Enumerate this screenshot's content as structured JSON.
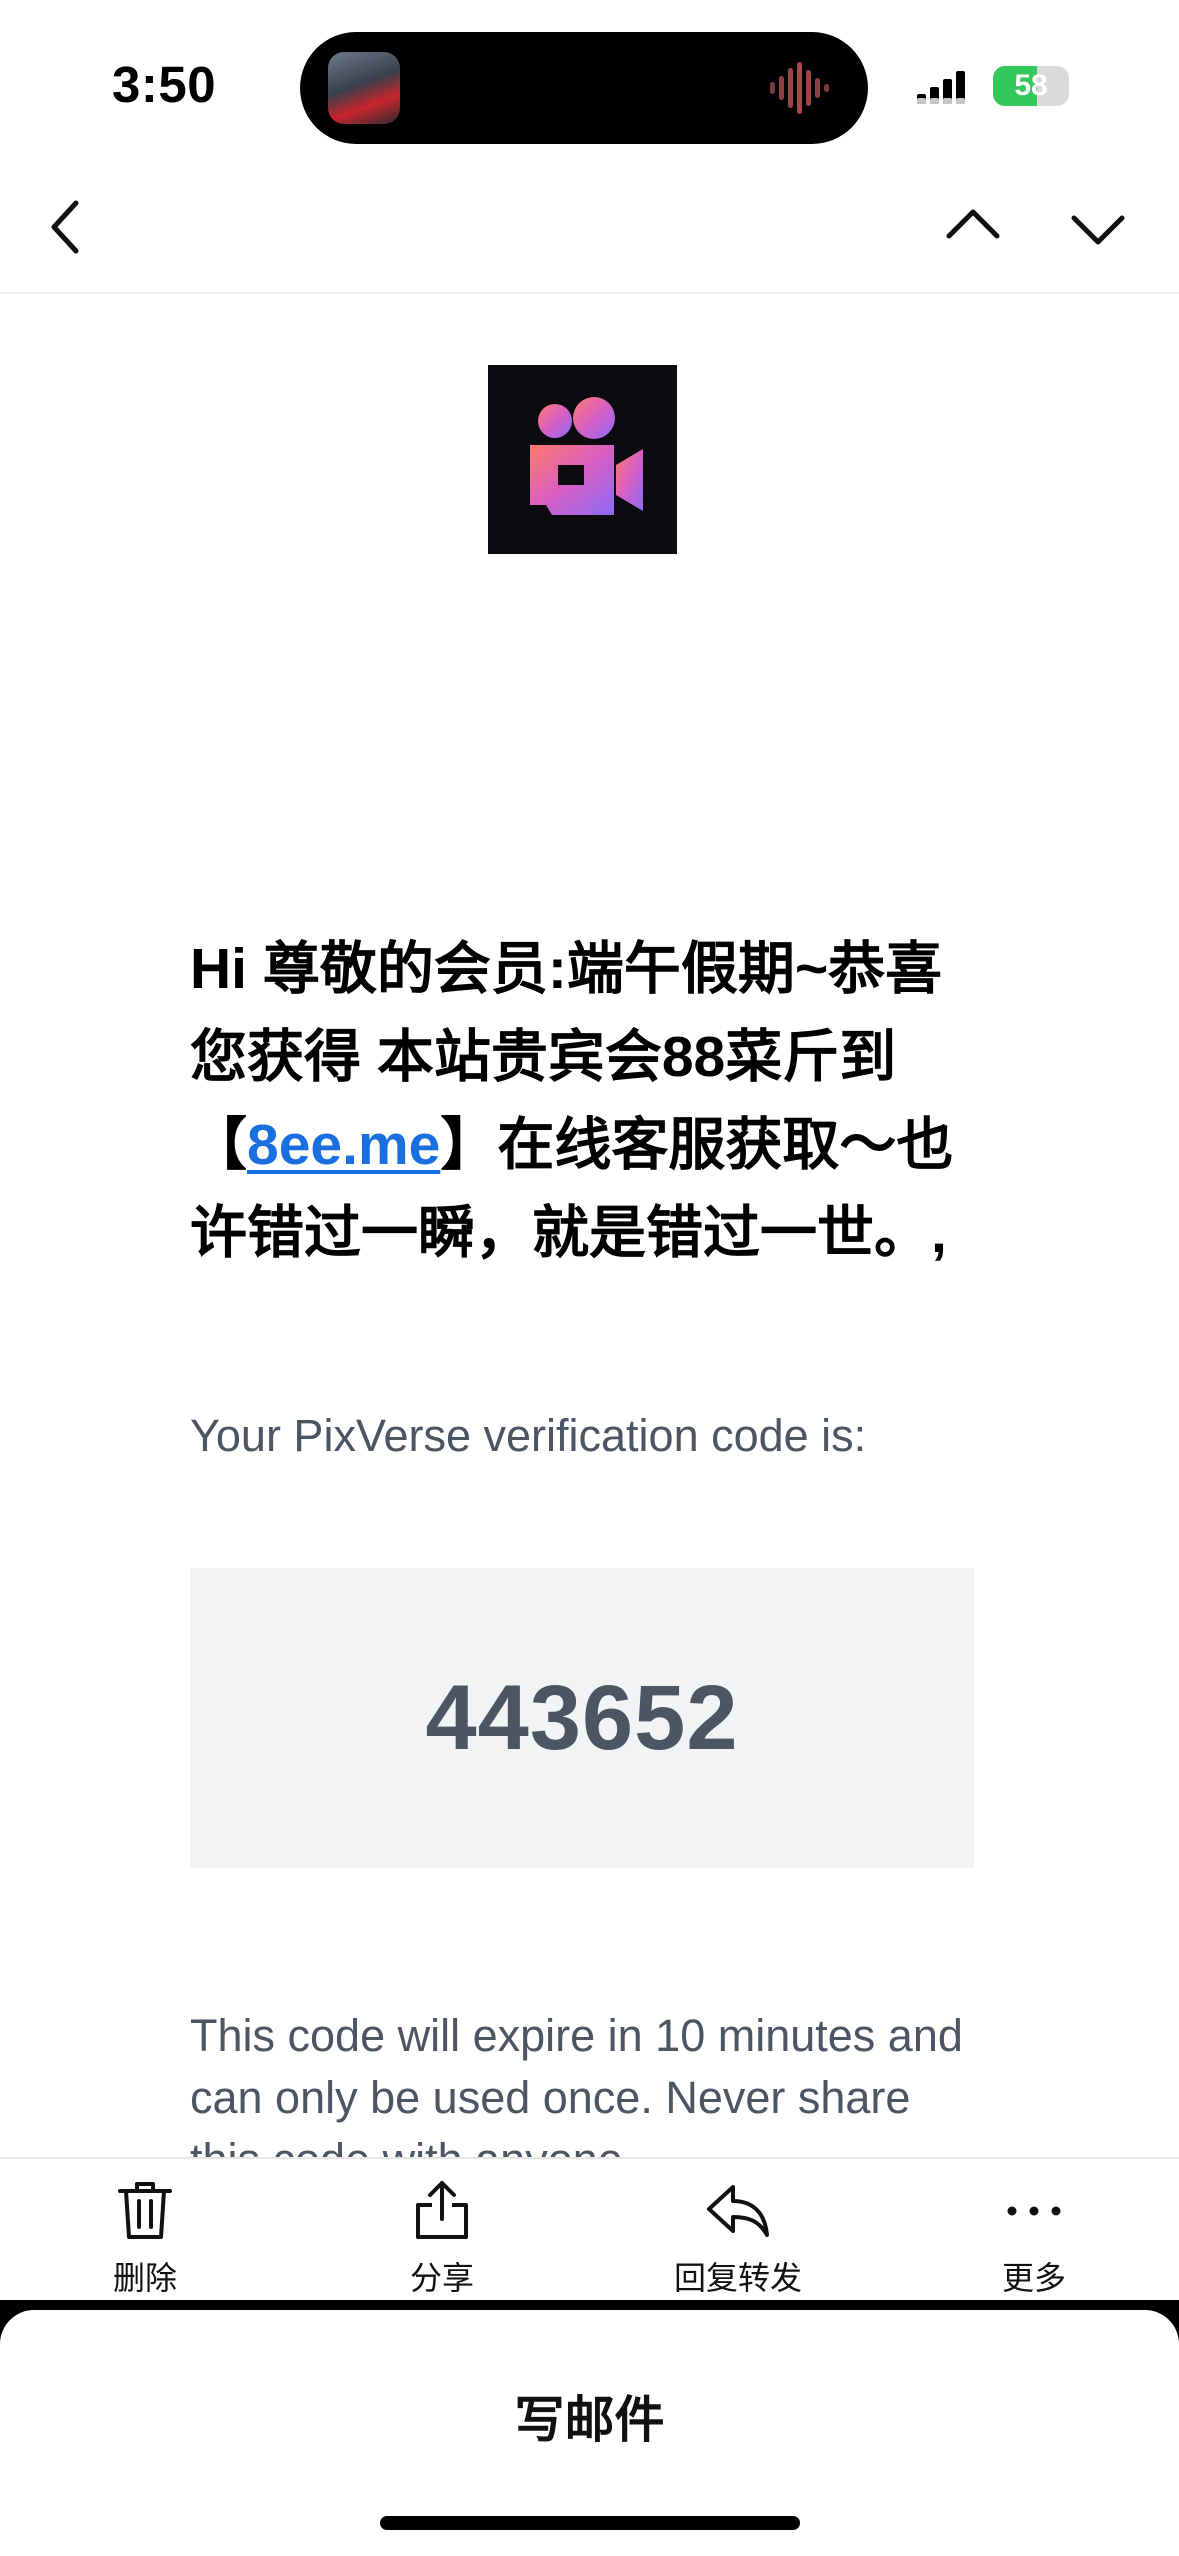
{
  "status_bar": {
    "time": "3:50",
    "battery_text": "58",
    "battery_level": 0.58
  },
  "nav": {
    "back_icon": "chevron-left-icon",
    "prev_icon": "chevron-up-icon",
    "next_icon": "chevron-down-icon"
  },
  "email": {
    "promo_prefix": "Hi 尊敬的会员:端午假期~恭喜您获得 本站贵宾会88菜斤到【",
    "promo_link": "8ee.me",
    "promo_suffix": "】在线客服获取～也许错过一瞬，就是错过一世。,",
    "verification_line": "Your PixVerse verification code is:",
    "code": "443652",
    "expire_text": "This code will expire in 10 minutes and can only be used once. Never share this code with anyone."
  },
  "toolbar": {
    "delete_label": "删除",
    "share_label": "分享",
    "reply_forward_label": "回复转发",
    "more_label": "更多"
  },
  "compose": {
    "label": "写邮件"
  },
  "colors": {
    "link": "#1a6fe0",
    "battery_green": "#34c759",
    "code_box_bg": "#f2f3f5",
    "body_gray": "#4b5563"
  }
}
